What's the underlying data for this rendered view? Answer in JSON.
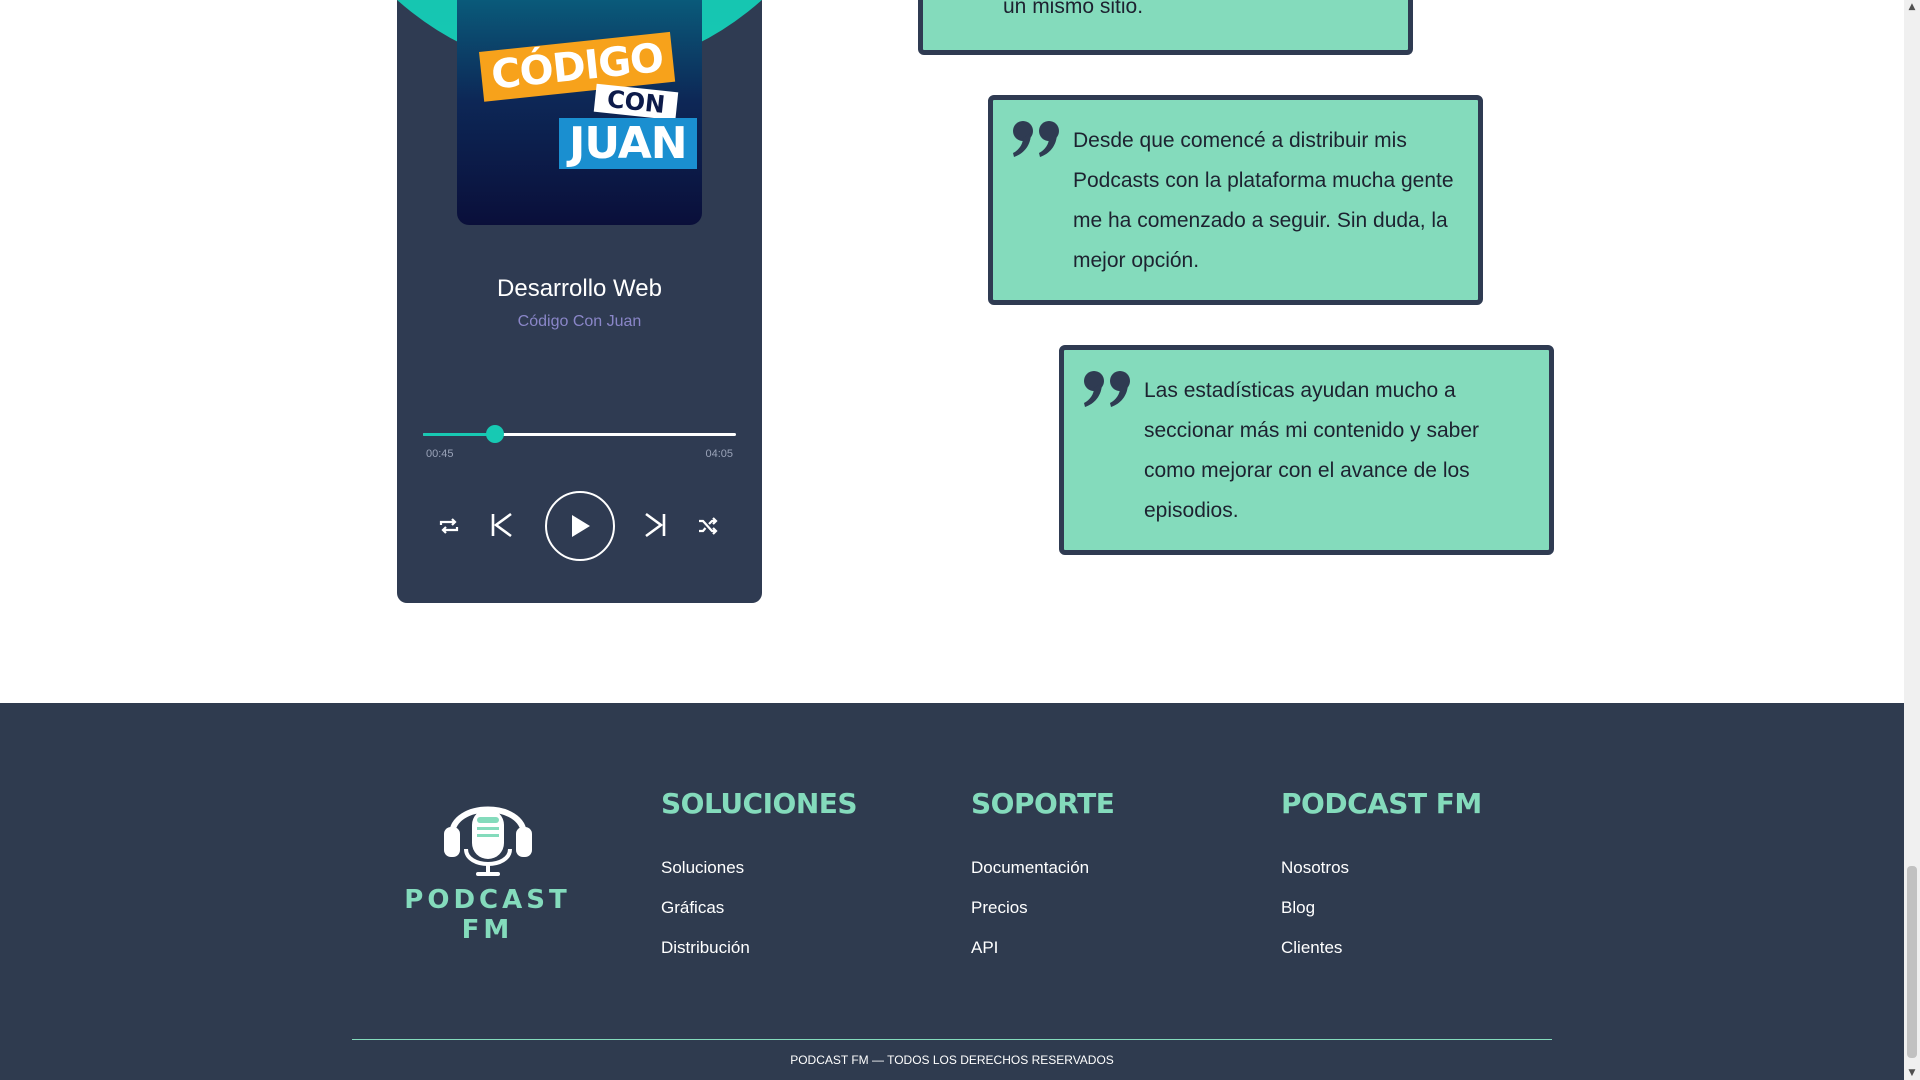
{
  "player": {
    "cover_logo": {
      "line1": "CÓDIGO",
      "line2": "CON",
      "line3": "JUAN"
    },
    "track_title": "Desarrollo Web",
    "track_artist": "Código Con Juan",
    "current_time": "00:45",
    "total_time": "04:05",
    "progress_fraction": 0.23,
    "controls": [
      "repeat-icon",
      "previous-icon",
      "play-icon",
      "next-icon",
      "shuffle-icon"
    ]
  },
  "testimonials": [
    {
      "text": "un mismo sitio."
    },
    {
      "text": "Desde que comencé a distribuir mis Podcasts con la plataforma mucha gente me ha comenzado a seguir. Sin duda, la mejor opción."
    },
    {
      "text": "Las estadísticas ayudan mucho a seccionar más mi contenido y saber como mejorar con el avance de los episodios."
    }
  ],
  "footer": {
    "brand_name": "PODCAST FM",
    "columns": [
      {
        "title": "SOLUCIONES",
        "links": [
          "Soluciones",
          "Gráficas",
          "Distribución"
        ]
      },
      {
        "title": "SOPORTE",
        "links": [
          "Documentación",
          "Precios",
          "API"
        ]
      },
      {
        "title": "PODCAST FM",
        "links": [
          "Nosotros",
          "Blog",
          "Clientes"
        ]
      }
    ],
    "copyright": "PODCAST FM — TODOS LOS DERECHOS RESERVADOS"
  },
  "colors": {
    "accent": "#84dbbc",
    "dark": "#2f3b4f",
    "teal": "#17c9b3",
    "artist": "#8a86c8"
  }
}
